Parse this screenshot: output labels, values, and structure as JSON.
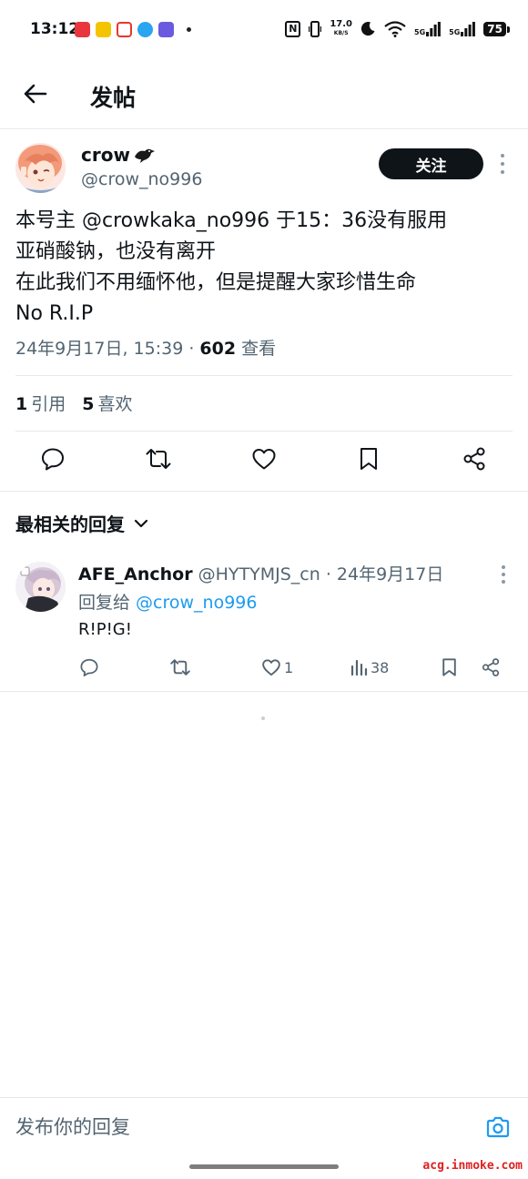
{
  "status_bar": {
    "time": "13:12",
    "net_speed_value": "17.0",
    "net_speed_unit": "KB/S",
    "signal_1": "5G",
    "signal_2": "5G",
    "battery": "75",
    "app_icon_colors": [
      "#e8363c",
      "#f5c400",
      "#e8372a",
      "#2aa5f0",
      "#6a5ae0"
    ]
  },
  "header": {
    "title": "发帖"
  },
  "tweet": {
    "author_name": "crow",
    "author_emoji": "🐦‍⬛",
    "author_handle": "@crow_no996",
    "follow_label": "关注",
    "text_lines": [
      "本号主 @crowkaka_no996 于15：36没有服用",
      "亚硝酸钠，也没有离开",
      "在此我们不用缅怀他，但是提醒大家珍惜生命",
      "No R.I.P"
    ],
    "timestamp": "24年9月17日, 15:39 · ",
    "views_count": "602",
    "views_label": " 查看",
    "quotes_count": "1",
    "quotes_label": "引用",
    "likes_count": "5",
    "likes_label": "喜欢"
  },
  "replies_section": {
    "sort_label": "最相关的回复"
  },
  "reply": {
    "name": "AFE_Anchor",
    "handle_and_date": " @HYTYMJS_cn · 24年9月17日",
    "reply_to_label": "回复给 ",
    "reply_to_handle": "@crow_no996",
    "text": "R!P!G!",
    "like_count": "1",
    "view_count": "38"
  },
  "composer": {
    "placeholder": "发布你的回复"
  },
  "watermark": "acg.inmoke.com",
  "colors": {
    "accent": "#1d9bf0",
    "text_primary": "#0f1419",
    "text_secondary": "#536471",
    "follow_bg": "#0f1419"
  }
}
